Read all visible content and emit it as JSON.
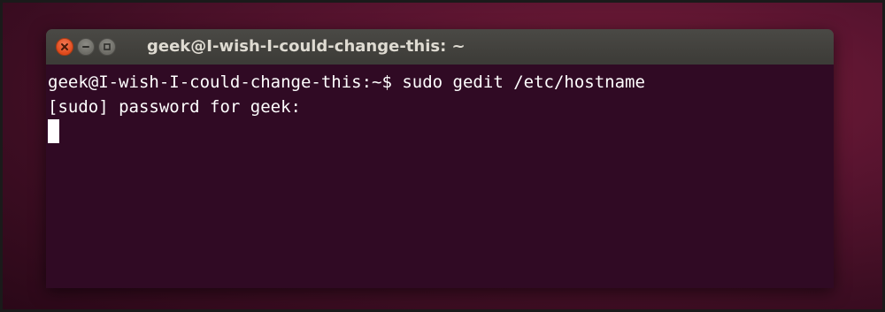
{
  "window": {
    "title": "geek@I-wish-I-could-change-this: ~"
  },
  "controls": {
    "close_icon": "close-icon",
    "minimize_icon": "minimize-icon",
    "maximize_icon": "maximize-icon"
  },
  "terminal": {
    "lines": [
      "geek@I-wish-I-could-change-this:~$ sudo gedit /etc/hostname",
      "[sudo] password for geek:"
    ]
  },
  "colors": {
    "terminal_bg": "#300a24",
    "terminal_fg": "#ffffff",
    "titlebar_bg": "#3c3b37",
    "close_button": "#e0491b"
  }
}
